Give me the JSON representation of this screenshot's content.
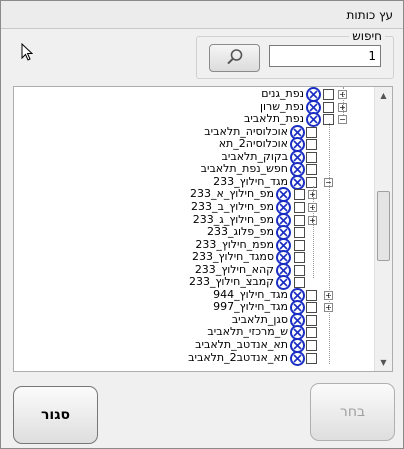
{
  "window": {
    "title": "עץ כותות"
  },
  "search": {
    "legend": "חיפוש",
    "value": "1",
    "button_icon": "magnifier-icon"
  },
  "tree": {
    "rows": [
      {
        "label": "נפת_גנים",
        "level": 0,
        "expander": "+"
      },
      {
        "label": "נפת_שרון",
        "level": 0,
        "expander": "+"
      },
      {
        "label": "נפת_תלאביב",
        "level": 0,
        "expander": "-"
      },
      {
        "label": "אוכלוסיה_תלאביב",
        "level": 1,
        "expander": ""
      },
      {
        "label": "אוכלוסיה2_תא",
        "level": 1,
        "expander": ""
      },
      {
        "label": "בקוק_תלאביב",
        "level": 1,
        "expander": ""
      },
      {
        "label": "חפש_נפת_תלאביב",
        "level": 1,
        "expander": ""
      },
      {
        "label": "מגד_חילוץ_233",
        "level": 1,
        "expander": "-"
      },
      {
        "label": "מפ_חילוץ_א_233",
        "level": 2,
        "expander": "+"
      },
      {
        "label": "מפ_חילוץ_ב_233",
        "level": 2,
        "expander": "+"
      },
      {
        "label": "מפ_חילוץ_ג_233",
        "level": 2,
        "expander": "+"
      },
      {
        "label": "מפ_פלוג_233",
        "level": 2,
        "expander": ""
      },
      {
        "label": "מפמ_חילוץ_233",
        "level": 2,
        "expander": ""
      },
      {
        "label": "סמגד_חילוץ_233",
        "level": 2,
        "expander": ""
      },
      {
        "label": "קהא_חילוץ_233",
        "level": 2,
        "expander": ""
      },
      {
        "label": "קמבצ_חילוץ_233",
        "level": 2,
        "expander": ""
      },
      {
        "label": "מגד_חילוץ_944",
        "level": 1,
        "expander": "+"
      },
      {
        "label": "מגד_חילוץ_997",
        "level": 1,
        "expander": "+"
      },
      {
        "label": "סגן_תלאביב",
        "level": 1,
        "expander": ""
      },
      {
        "label": "ש_מרכזי_תלאביב",
        "level": 1,
        "expander": ""
      },
      {
        "label": "תא_אנדטב_תלאביב",
        "level": 1,
        "expander": ""
      },
      {
        "label": "תא_אנדטב2_תלאביב",
        "level": 1,
        "expander": ""
      }
    ]
  },
  "buttons": {
    "close": "סגור",
    "select": "בחר"
  },
  "colors": {
    "icon_blue": "#1a2ec4",
    "disabled_text": "#a0a0a0"
  }
}
